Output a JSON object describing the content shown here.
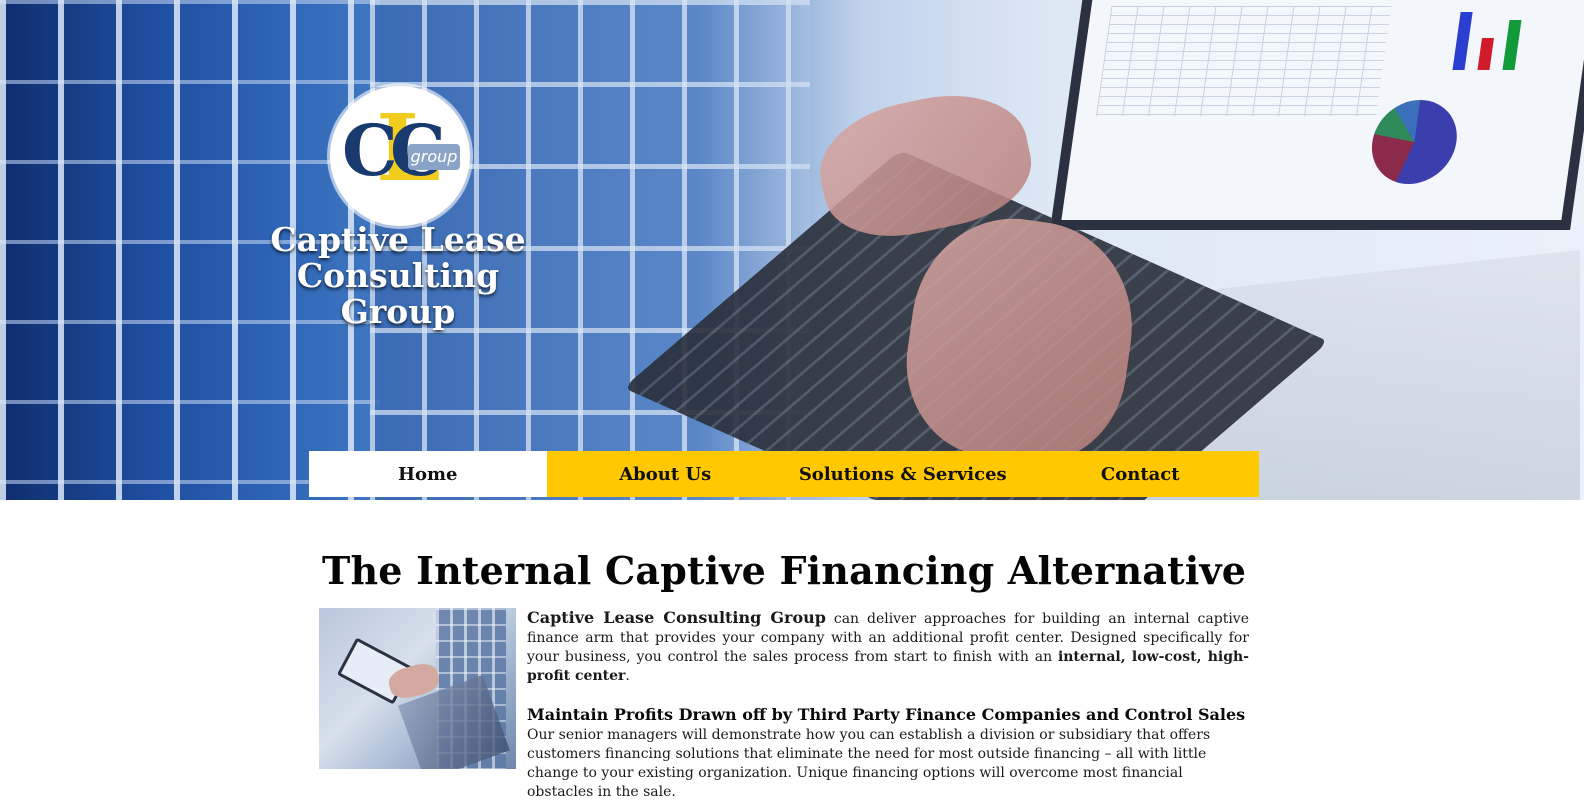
{
  "brand": {
    "logo_letters": [
      "C",
      "L",
      "C"
    ],
    "logo_group_word": "group",
    "name_line1": "Captive Lease",
    "name_line2": "Consulting Group"
  },
  "nav": {
    "items": [
      {
        "label": "Home",
        "active": true
      },
      {
        "label": "About Us",
        "active": false
      },
      {
        "label": "Solutions & Services",
        "active": false
      },
      {
        "label": "Contact",
        "active": false
      }
    ]
  },
  "main": {
    "title": "The Internal Captive Financing Alternative",
    "intro_company": "Captive Lease Consulting Group",
    "intro_text": " can deliver approaches for building an internal captive finance arm that provides your company with an additional profit center. Designed specifically for your business, you control the sales process from start to finish with an ",
    "intro_bold": "internal, low-cost, high-profit center",
    "intro_end": ".",
    "section_heading": "Maintain Profits Drawn off by Third Party Finance Companies and Control Sales",
    "section_text": "Our senior managers will demonstrate how you can establish a division or subsidiary that offers customers financing solutions that eliminate the need for most outside financing – all with little change to your existing organization. Unique financing options will overcome most financial obstacles in the sale."
  },
  "colors": {
    "nav_bg": "#ffc800",
    "nav_active_bg": "#ffffff",
    "logo_navy": "#183a6e",
    "logo_gold": "#f2cc1c"
  },
  "icons": {
    "logo": "clc-group-logo"
  }
}
